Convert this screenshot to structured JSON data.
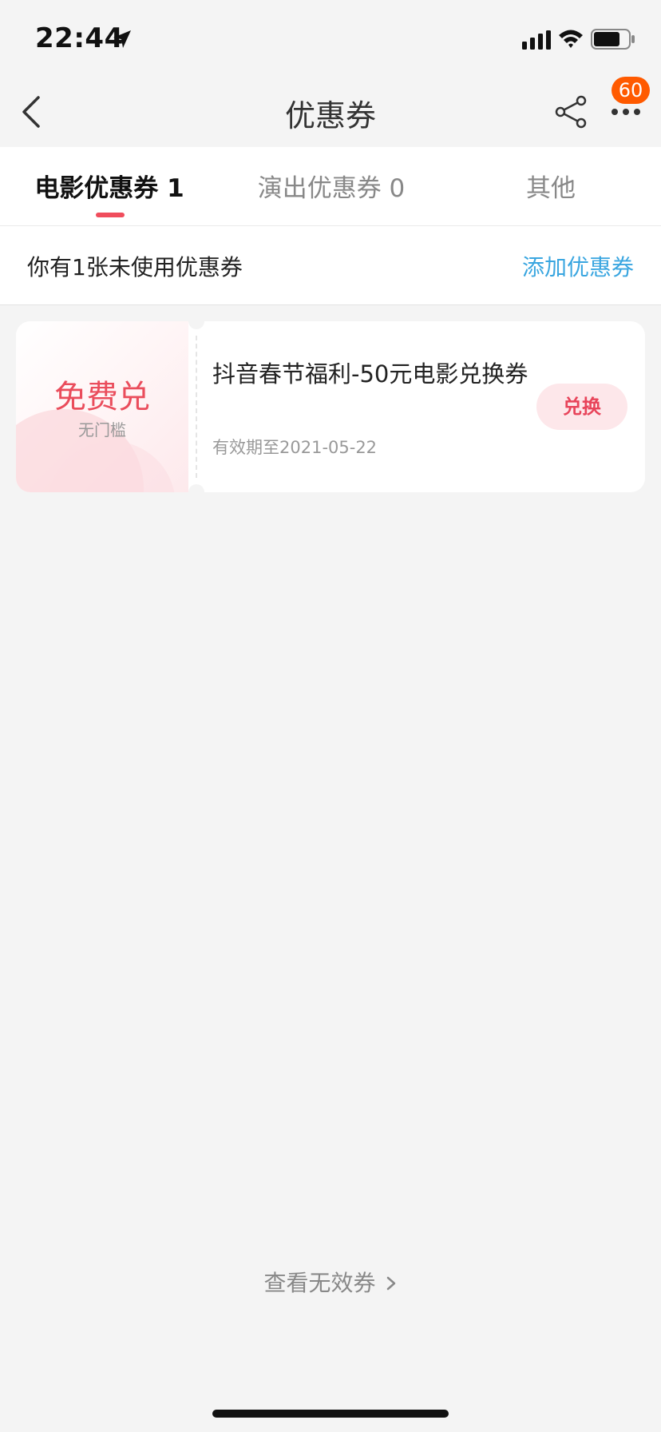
{
  "status_bar": {
    "time": "22:44"
  },
  "nav": {
    "title": "优惠券",
    "badge_count": "60"
  },
  "tabs": [
    {
      "label": "电影优惠券 1",
      "active": true
    },
    {
      "label": "演出优惠券 0",
      "active": false
    },
    {
      "label": "其他",
      "active": false
    }
  ],
  "summary": {
    "text": "你有1张未使用优惠券",
    "add_link": "添加优惠券"
  },
  "coupons": [
    {
      "value": "免费兑",
      "threshold": "无门槛",
      "title": "抖音春节福利-50元电影兑换券",
      "expiry": "有效期至2021-05-22",
      "action": "兑换"
    }
  ],
  "footer": {
    "invalid_link": "查看无效券"
  },
  "colors": {
    "accent": "#f04d5c",
    "link": "#3aa6e0",
    "badge": "#ff5a00",
    "background": "#f4f4f4"
  },
  "icons": [
    "location-arrow-icon",
    "signal-icon",
    "wifi-icon",
    "battery-icon",
    "back-icon",
    "share-icon",
    "more-icon",
    "chevron-right-icon"
  ]
}
